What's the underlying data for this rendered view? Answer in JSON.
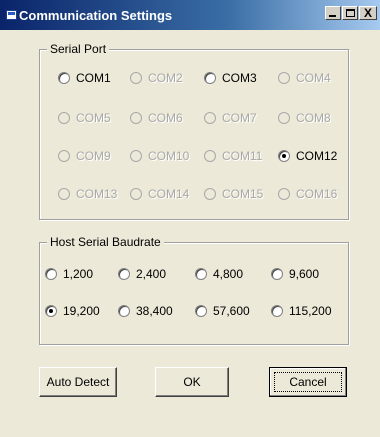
{
  "window": {
    "title": "Communication Settings"
  },
  "title_controls": {
    "minimize": "_",
    "maximize": "□",
    "close": "X"
  },
  "serial_port": {
    "label": "Serial Port",
    "ports": [
      {
        "label": "COM1",
        "enabled": true,
        "checked": false
      },
      {
        "label": "COM2",
        "enabled": false,
        "checked": false
      },
      {
        "label": "COM3",
        "enabled": true,
        "checked": false
      },
      {
        "label": "COM4",
        "enabled": false,
        "checked": false
      },
      {
        "label": "COM5",
        "enabled": false,
        "checked": false
      },
      {
        "label": "COM6",
        "enabled": false,
        "checked": false
      },
      {
        "label": "COM7",
        "enabled": false,
        "checked": false
      },
      {
        "label": "COM8",
        "enabled": false,
        "checked": false
      },
      {
        "label": "COM9",
        "enabled": false,
        "checked": false
      },
      {
        "label": "COM10",
        "enabled": false,
        "checked": false
      },
      {
        "label": "COM11",
        "enabled": false,
        "checked": false
      },
      {
        "label": "COM12",
        "enabled": true,
        "checked": true
      },
      {
        "label": "COM13",
        "enabled": false,
        "checked": false
      },
      {
        "label": "COM14",
        "enabled": false,
        "checked": false
      },
      {
        "label": "COM15",
        "enabled": false,
        "checked": false
      },
      {
        "label": "COM16",
        "enabled": false,
        "checked": false
      }
    ]
  },
  "baudrate": {
    "label": "Host Serial Baudrate",
    "options": [
      {
        "label": "1,200",
        "checked": false
      },
      {
        "label": "2,400",
        "checked": false
      },
      {
        "label": "4,800",
        "checked": false
      },
      {
        "label": "9,600",
        "checked": false
      },
      {
        "label": "19,200",
        "checked": true
      },
      {
        "label": "38,400",
        "checked": false
      },
      {
        "label": "57,600",
        "checked": false
      },
      {
        "label": "115,200",
        "checked": false
      }
    ]
  },
  "buttons": {
    "auto_detect": "Auto Detect",
    "ok": "OK",
    "cancel": "Cancel"
  },
  "colors": {
    "titlebar_start": "#0a246a",
    "titlebar_end": "#a6caf0",
    "face": "#ece9d8",
    "disabled_text": "#a8a8a8"
  }
}
